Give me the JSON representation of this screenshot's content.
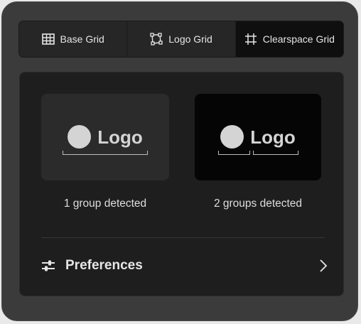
{
  "tabs": [
    {
      "label": "Base Grid",
      "icon": "base-grid-icon",
      "active": false
    },
    {
      "label": "Logo Grid",
      "icon": "logo-grid-icon",
      "active": false
    },
    {
      "label": "Clearspace Grid",
      "icon": "clearspace-grid-icon",
      "active": true
    }
  ],
  "cards": [
    {
      "logo_text": "Logo",
      "caption": "1 group detected"
    },
    {
      "logo_text": "Logo",
      "caption": "2 groups detected"
    }
  ],
  "preferences": {
    "label": "Preferences",
    "icon": "sliders-icon",
    "chevron": "chevron-right-icon"
  },
  "colors": {
    "panel": "#3b3b3b",
    "content": "#1e1e1e",
    "active_tab": "#0f0f0f",
    "text": "#e6e6e6"
  }
}
